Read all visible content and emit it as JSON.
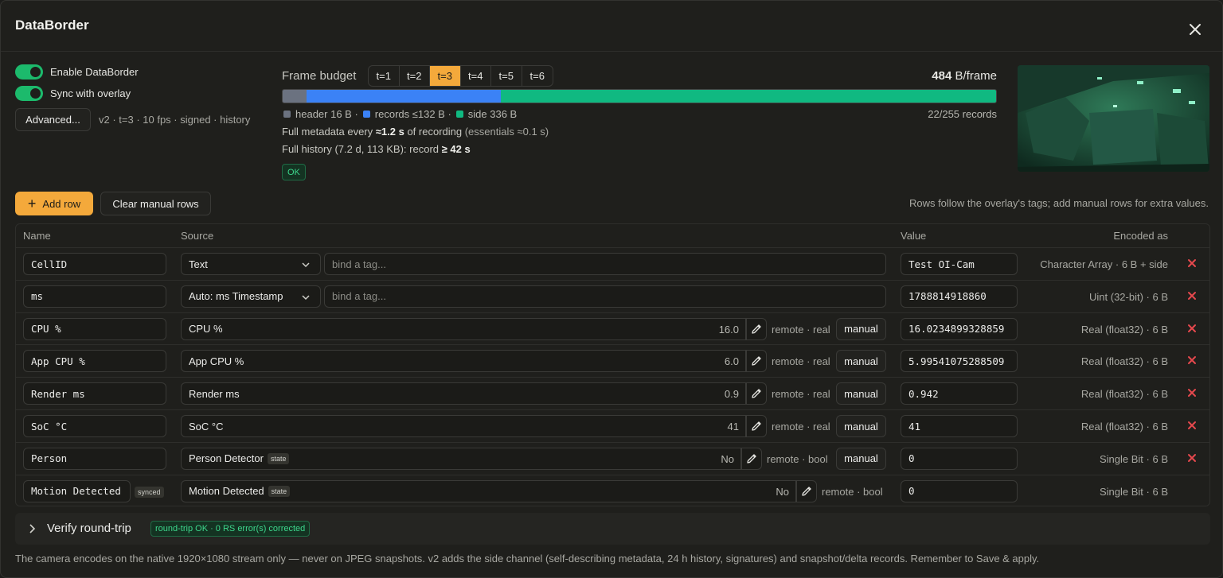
{
  "dialog": {
    "title": "DataBorder"
  },
  "toggles": [
    {
      "label": "Enable DataBorder",
      "on": true
    },
    {
      "label": "Sync with overlay",
      "on": true
    }
  ],
  "advanced": {
    "label": "Advanced...",
    "summary": "v2 · t=3 · 10 fps · signed · history"
  },
  "frame_budget": {
    "label": "Frame budget",
    "tabs": [
      "t=1",
      "t=2",
      "t=3",
      "t=4",
      "t=5",
      "t=6"
    ],
    "active_tab": "t=3",
    "bytes_value": "484",
    "bytes_unit": "B/frame",
    "bar": [
      {
        "name": "header",
        "bytes": 16,
        "color": "#6b7280"
      },
      {
        "name": "records",
        "bytes": 132,
        "color": "#3b82f6"
      },
      {
        "name": "side",
        "bytes": 336,
        "color": "#10b981"
      }
    ],
    "legend": {
      "header": "header 16 B ·",
      "records": "records ≤132 B ·",
      "side": "side 336 B"
    },
    "records_count": "22/255 records",
    "meta_line_a": "Full metadata every ",
    "meta_line_b": "≈1.2 s",
    "meta_line_c": " of recording ",
    "meta_line_d": "(essentials ≈0.1 s)",
    "history_a": "Full history (7.2 d, 113 KB): record ",
    "history_b": "≥ 42 s",
    "status": "OK"
  },
  "toolbar": {
    "add_row": "Add row",
    "clear_manual": "Clear manual rows",
    "hint": "Rows follow the overlay's tags; add manual rows for extra values."
  },
  "table": {
    "headers": {
      "name": "Name",
      "source": "Source",
      "value": "Value",
      "encoded": "Encoded as"
    },
    "rows": [
      {
        "name": "CellID",
        "source_kind": "select",
        "source": "Text",
        "tag_placeholder": "bind a tag...",
        "value": "Test OI-Cam",
        "encoded": "Character Array · 6 B + side",
        "deletable": true
      },
      {
        "name": "ms",
        "source_kind": "select",
        "source": "Auto: ms Timestamp",
        "tag_placeholder": "bind a tag...",
        "value": "1788814918860",
        "encoded": "Uint (32-bit) · 6 B",
        "deletable": true
      },
      {
        "name": "CPU %",
        "source_kind": "remote",
        "source": "CPU %",
        "reading": "16.0",
        "meta": "remote · real",
        "manual": "manual",
        "value": "16.0234899328859",
        "encoded": "Real (float32) · 6 B",
        "deletable": true
      },
      {
        "name": "App CPU %",
        "source_kind": "remote",
        "source": "App CPU %",
        "reading": "6.0",
        "meta": "remote · real",
        "manual": "manual",
        "value": "5.99541075288509",
        "encoded": "Real (float32) · 6 B",
        "deletable": true
      },
      {
        "name": "Render ms",
        "source_kind": "remote",
        "source": "Render ms",
        "reading": "0.9",
        "meta": "remote · real",
        "manual": "manual",
        "value": "0.942",
        "encoded": "Real (float32) · 6 B",
        "deletable": true
      },
      {
        "name": "SoC °C",
        "source_kind": "remote",
        "source": "SoC °C",
        "reading": "41",
        "meta": "remote · real",
        "manual": "manual",
        "value": "41",
        "encoded": "Real (float32) · 6 B",
        "deletable": true
      },
      {
        "name": "Person",
        "source_kind": "state",
        "source": "Person Detector",
        "state_tag": "state",
        "reading": "No",
        "meta": "remote · bool",
        "manual": "manual",
        "value": "0",
        "encoded": "Single Bit · 6 B",
        "deletable": true
      },
      {
        "name": "Motion Detected",
        "name_tag": "synced",
        "source_kind": "state",
        "source": "Motion Detected",
        "state_tag": "state",
        "reading": "No",
        "meta": "remote · bool",
        "value": "0",
        "encoded": "Single Bit · 6 B",
        "deletable": false
      }
    ]
  },
  "verify": {
    "label": "Verify round-trip",
    "badge": "round-trip OK · 0 RS error(s) corrected"
  },
  "footer": "The camera encodes on the native 1920×1080 stream only — never on JPEG snapshots. v2 adds the side channel (self-describing metadata, 24 h history, signatures) and snapshot/delta records. Remember to Save & apply.",
  "icons": {
    "close": "close-icon",
    "add": "plus-icon",
    "edit": "pencil-icon",
    "delete": "x-delete-icon",
    "dropdown": "chevron-down-icon",
    "expand": "chevron-right-icon"
  },
  "colors": {
    "accent": "#f4a93b",
    "toggle_on": "#1cba6c",
    "ok": "#3dd68c",
    "delete": "#e5484d"
  }
}
